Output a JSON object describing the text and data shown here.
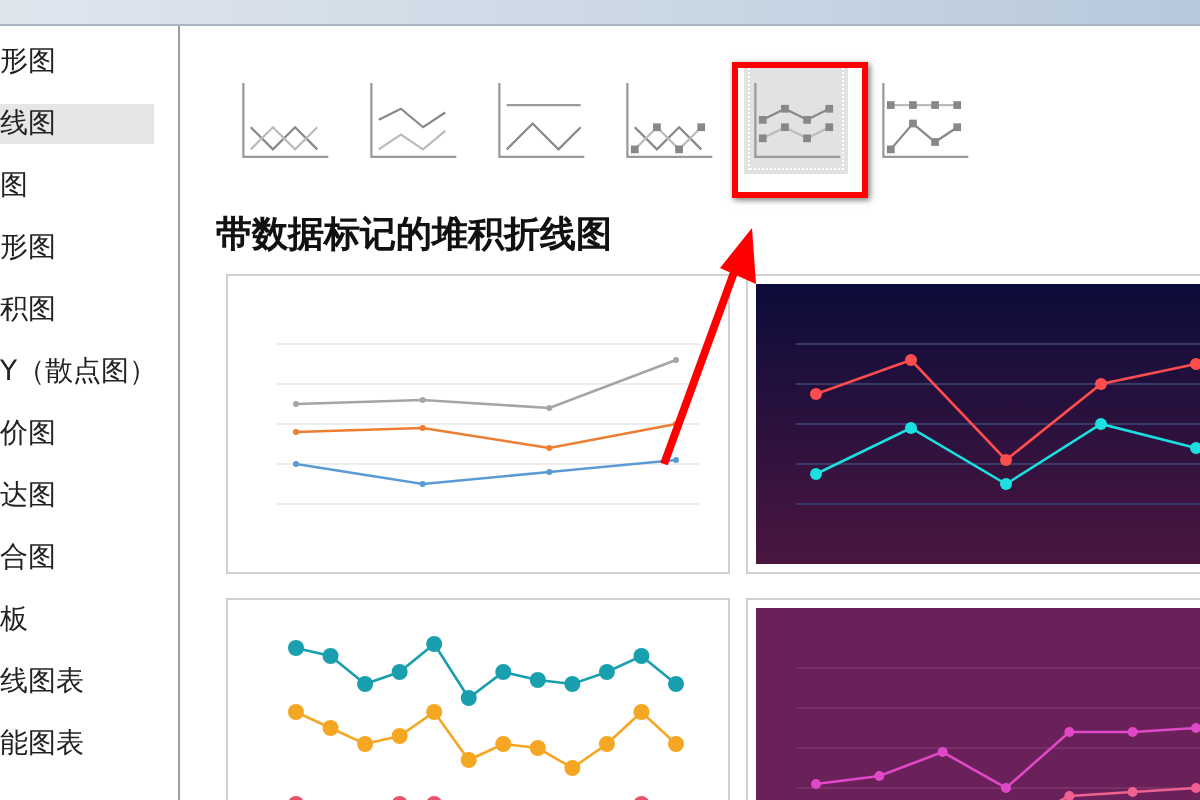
{
  "sidebar": {
    "items": [
      {
        "label": "形图",
        "selected": false
      },
      {
        "label": "线图",
        "selected": true
      },
      {
        "label": "图",
        "selected": false
      },
      {
        "label": "形图",
        "selected": false
      },
      {
        "label": "积图",
        "selected": false
      },
      {
        "label": "Y（散点图）",
        "selected": false
      },
      {
        "label": "价图",
        "selected": false
      },
      {
        "label": "达图",
        "selected": false
      },
      {
        "label": "合图",
        "selected": false
      },
      {
        "label": "板",
        "selected": false
      },
      {
        "label": "线图表",
        "selected": false
      },
      {
        "label": "能图表",
        "selected": false
      }
    ]
  },
  "chart_types": [
    {
      "kind": "line",
      "selected": false
    },
    {
      "kind": "stacked",
      "selected": false
    },
    {
      "kind": "percent",
      "selected": false
    },
    {
      "kind": "line-markers",
      "selected": false
    },
    {
      "kind": "stacked-markers",
      "selected": true
    },
    {
      "kind": "percent-markers",
      "selected": false
    }
  ],
  "heading": "带数据标记的堆积折线图",
  "previews": [
    {
      "kind": "light"
    },
    {
      "kind": "dark"
    },
    {
      "kind": "dots"
    },
    {
      "kind": "purple"
    }
  ]
}
